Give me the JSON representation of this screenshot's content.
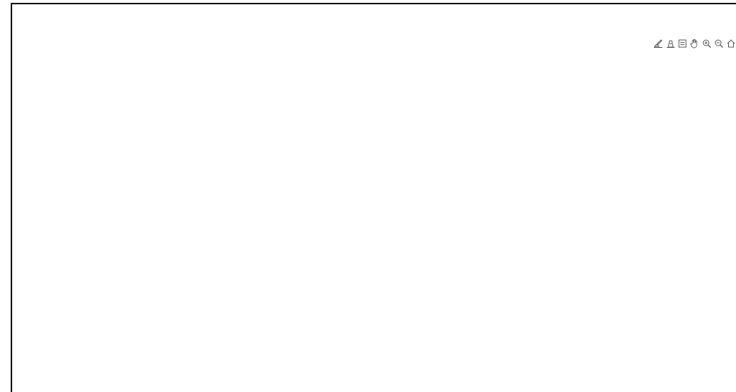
{
  "toolbar": {
    "icons": [
      "brush-icon",
      "data-cursor-icon",
      "legend-icon",
      "pan-hand-icon",
      "zoom-in-icon",
      "zoom-out-icon",
      "home-icon"
    ]
  },
  "colors": {
    "atmosphere_fill": "#c8e0e7",
    "atmosphere_stroke": "#222222",
    "ground_line": "#9a9a9a",
    "landing_pad": "#2e9e6e",
    "rocket_body": "#111111",
    "rocket_flame": "#e07a30",
    "frame": "#000000"
  }
}
